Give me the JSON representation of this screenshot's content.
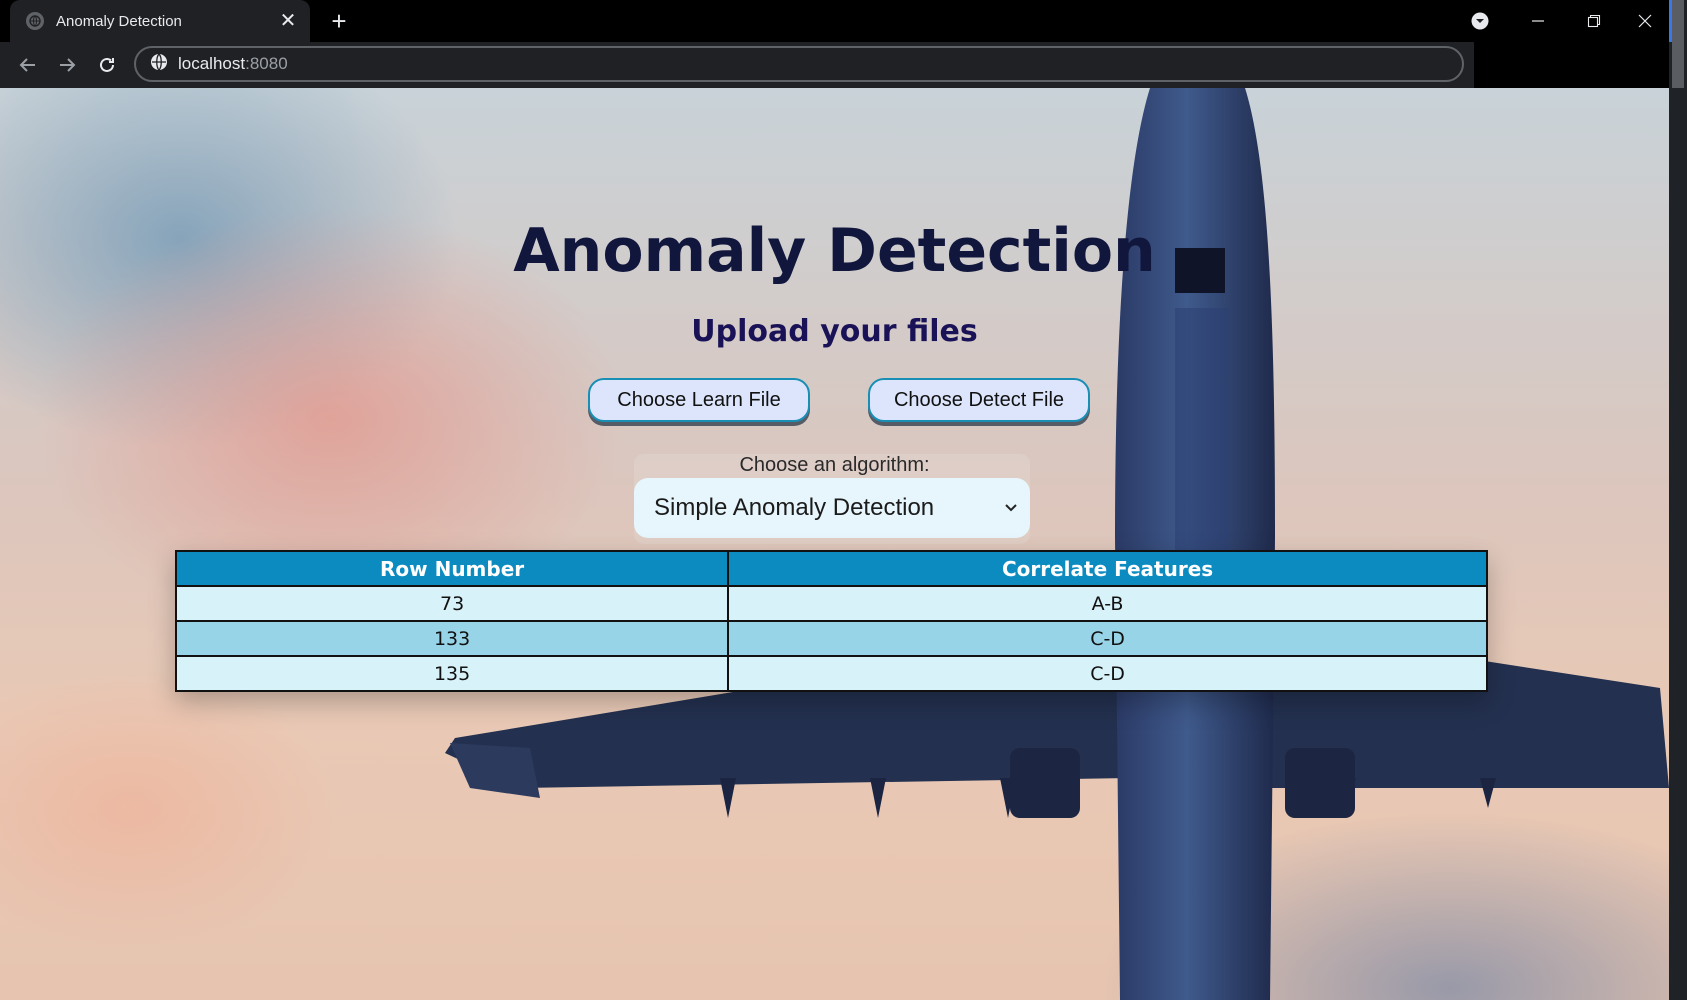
{
  "browser": {
    "tab_title": "Anomaly Detection",
    "tab_close": "✕",
    "new_tab": "+",
    "url_host": "localhost",
    "url_port": ":8080",
    "window_controls": {
      "minimize": "—",
      "restore": "❐",
      "close": "✕"
    },
    "icons": [
      "back-icon",
      "forward-icon",
      "reload-icon",
      "site-info-icon",
      "profile-menu-icon"
    ]
  },
  "page": {
    "title": "Anomaly Detection",
    "subtitle": "Upload your files",
    "learn_button": "Choose Learn File",
    "detect_button": "Choose Detect File",
    "algorithm_label": "Choose an algorithm:",
    "algorithm_selected": "Simple Anomaly Detection",
    "table": {
      "headers": [
        "Row Number",
        "Correlate Features"
      ],
      "rows": [
        [
          "73",
          "A-B"
        ],
        [
          "133",
          "C-D"
        ],
        [
          "135",
          "C-D"
        ]
      ]
    }
  },
  "colors": {
    "title": "#11163d",
    "subtitle": "#1a1257",
    "table_header": "#0c8bc0",
    "row_light": "#d8f2fa",
    "row_dark": "#98d4e8",
    "button_bg": "#dce5fb",
    "button_border": "#1a8fb5"
  }
}
